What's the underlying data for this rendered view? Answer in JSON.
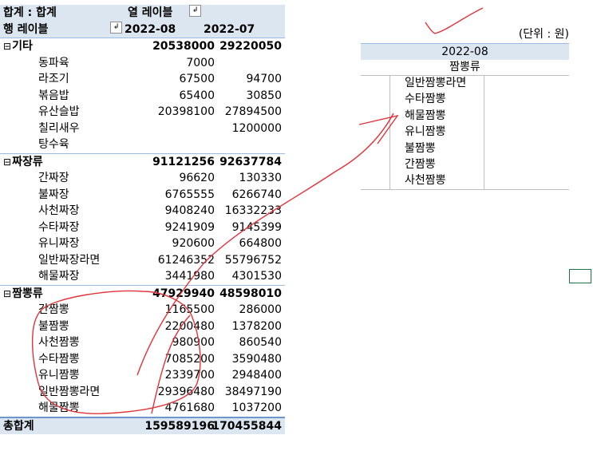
{
  "pivot": {
    "header1": {
      "values_label": "합계 : 합계",
      "col_labels_title": "열 레이블",
      "filter_icon": "dropdown-filter-icon"
    },
    "header2": {
      "row_labels_title": "행 레이블",
      "sort_icon": "sort-filter-icon",
      "col1": "2022-08",
      "col2": "2022-07"
    },
    "groups": [
      {
        "name": "기타",
        "collapse": "⊟",
        "v08": "20538000",
        "v07": "29220050",
        "items": [
          {
            "name": "동파육",
            "v08": "7000",
            "v07": ""
          },
          {
            "name": "라조기",
            "v08": "67500",
            "v07": "94700"
          },
          {
            "name": "볶음밥",
            "v08": "65400",
            "v07": "30850"
          },
          {
            "name": "유산슬밥",
            "v08": "20398100",
            "v07": "27894500"
          },
          {
            "name": "칠리새우",
            "v08": "",
            "v07": "1200000"
          },
          {
            "name": "탕수육",
            "v08": "",
            "v07": ""
          }
        ]
      },
      {
        "name": "짜장류",
        "collapse": "⊟",
        "v08": "91121256",
        "v07": "92637784",
        "items": [
          {
            "name": "간짜장",
            "v08": "96620",
            "v07": "130330"
          },
          {
            "name": "불짜장",
            "v08": "6765555",
            "v07": "6266740"
          },
          {
            "name": "사천짜장",
            "v08": "9408240",
            "v07": "16332233"
          },
          {
            "name": "수타짜장",
            "v08": "9241909",
            "v07": "9145399"
          },
          {
            "name": "유니짜장",
            "v08": "920600",
            "v07": "664800"
          },
          {
            "name": "일반짜장라면",
            "v08": "61246352",
            "v07": "55796752"
          },
          {
            "name": "해물짜장",
            "v08": "3441980",
            "v07": "4301530"
          }
        ]
      },
      {
        "name": "짬뽕류",
        "collapse": "⊟",
        "v08": "47929940",
        "v07": "48598010",
        "items": [
          {
            "name": "간짬뽕",
            "v08": "1165500",
            "v07": "286000"
          },
          {
            "name": "불짬뽕",
            "v08": "2200480",
            "v07": "1378200"
          },
          {
            "name": "사천짬뽕",
            "v08": "980900",
            "v07": "860540"
          },
          {
            "name": "수타짬뽕",
            "v08": "7085200",
            "v07": "3590480"
          },
          {
            "name": "유니짬뽕",
            "v08": "2339700",
            "v07": "2948400"
          },
          {
            "name": "일반짬뽕라면",
            "v08": "29396480",
            "v07": "38497190"
          },
          {
            "name": "해물짬뽕",
            "v08": "4761680",
            "v07": "1037200"
          }
        ]
      }
    ],
    "grand_total": {
      "label": "총합계",
      "v08": "159589196",
      "v07": "170455844"
    }
  },
  "side": {
    "unit": "(단위 : 원)",
    "header": "2022-08",
    "sub": "짬뽕류",
    "items": [
      "일반짬뽕라면",
      "수타짬뽕",
      "해물짬뽕",
      "유니짬뽕",
      "불짬뽕",
      "간짬뽕",
      "사천짬뽕"
    ]
  },
  "colors": {
    "header_bg": "#dce6f1",
    "border_blue": "#9bbbe3",
    "ink_red": "#e0343a"
  }
}
